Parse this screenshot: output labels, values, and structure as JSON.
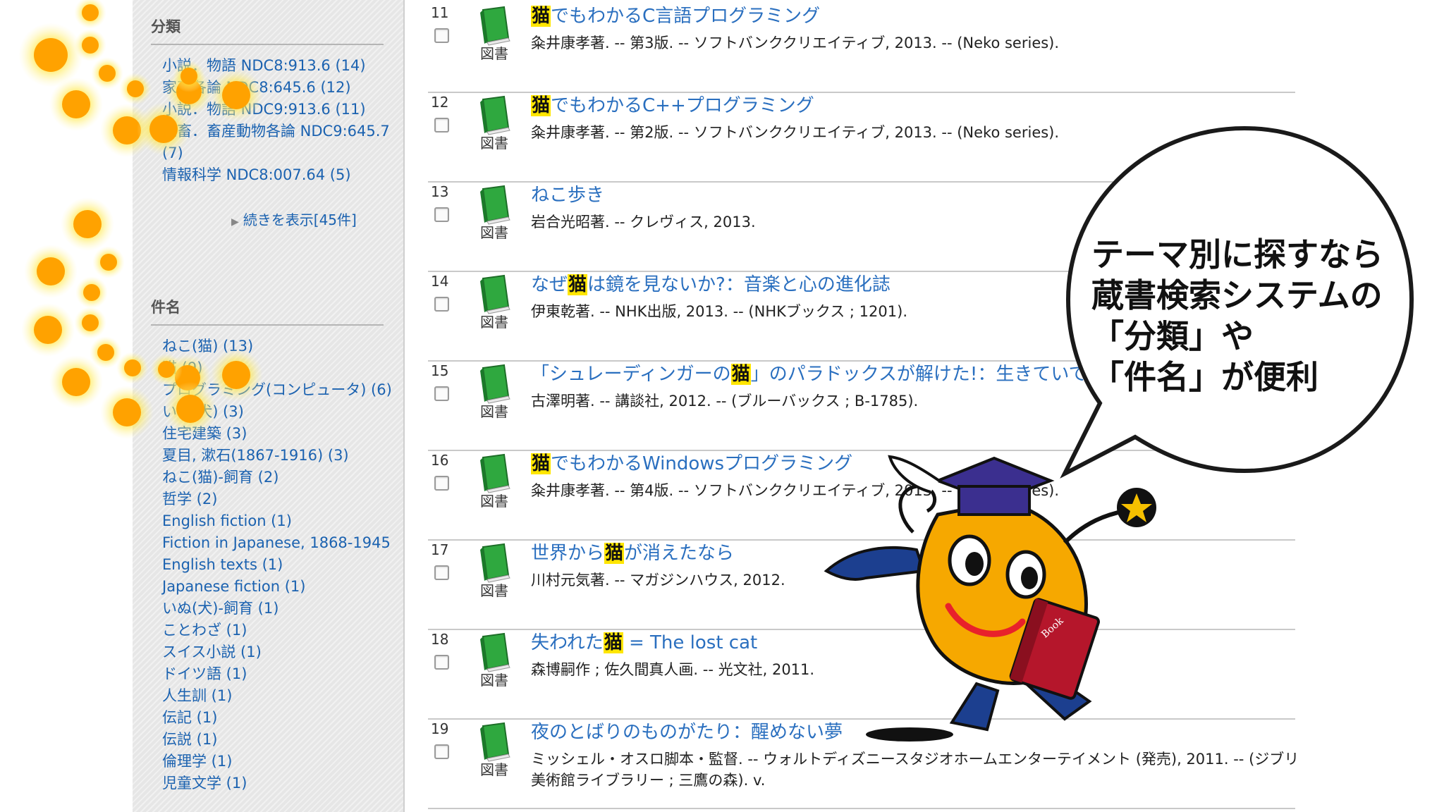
{
  "sidebar": {
    "classification": {
      "heading": "分類",
      "items": [
        "小説．物語 NDC8:913.6 (14)",
        "家畜各論 NDC8:645.6 (12)",
        "小説．物語 NDC9:913.6 (11)",
        "家畜．畜産動物各論 NDC9:645.7 (7)",
        "情報科学 NDC8:007.64 (5)"
      ],
      "show_more": "続きを表示[45件]"
    },
    "subjects": {
      "heading": "件名",
      "items": [
        "ねこ(猫) (13)",
        "猫 (9)",
        "プログラミング(コンピュータ) (6)",
        "いぬ(犬) (3)",
        "住宅建築 (3)",
        "夏目, 漱石(1867-1916) (3)",
        "ねこ(猫)-飼育 (2)",
        "哲学 (2)",
        "English fiction (1)",
        "Fiction in Japanese, 1868-1945 English texts (1)",
        "Japanese fiction (1)",
        "いぬ(犬)-飼育 (1)",
        "ことわざ (1)",
        "スイス小説 (1)",
        "ドイツ語 (1)",
        "人生訓 (1)",
        "伝記 (1)",
        "伝説 (1)",
        "倫理学 (1)",
        "児童文学 (1)"
      ]
    }
  },
  "results": [
    {
      "num": "11",
      "type": "図書",
      "title_before": "",
      "title_highlight": "猫",
      "title_after": "でもわかるC言語プログラミング",
      "meta": "粂井康孝著. -- 第3版. -- ソフトバンククリエイティブ, 2013. -- (Neko series)."
    },
    {
      "num": "12",
      "type": "図書",
      "title_before": "",
      "title_highlight": "猫",
      "title_after": "でもわかるC++プログラミング",
      "meta": "粂井康孝著. -- 第2版. -- ソフトバンククリエイティブ, 2013. -- (Neko series)."
    },
    {
      "num": "13",
      "type": "図書",
      "title_before": "ねこ歩き",
      "title_highlight": "",
      "title_after": "",
      "meta": "岩合光昭著. -- クレヴィス, 2013."
    },
    {
      "num": "14",
      "type": "図書",
      "title_before": "なぜ",
      "title_highlight": "猫",
      "title_after": "は鏡を見ないか?：音楽と心の進化誌",
      "meta": "伊東乾著. -- NHK出版, 2013. -- (NHKブックス ; 1201)."
    },
    {
      "num": "15",
      "type": "図書",
      "title_before": "「シュレーディンガーの",
      "title_highlight": "猫",
      "title_after": "」のパラドックスが解けた!：生きていて死",
      "meta": "古澤明著. -- 講談社, 2012. -- (ブルーバックス ; B-1785)."
    },
    {
      "num": "16",
      "type": "図書",
      "title_before": "",
      "title_highlight": "猫",
      "title_after": "でもわかるWindowsプログラミング",
      "meta": "粂井康孝著. -- 第4版. -- ソフトバンククリエイティブ, 2013. -- (Neko series)."
    },
    {
      "num": "17",
      "type": "図書",
      "title_before": "世界から",
      "title_highlight": "猫",
      "title_after": "が消えたなら",
      "meta": "川村元気著. -- マガジンハウス, 2012."
    },
    {
      "num": "18",
      "type": "図書",
      "title_before": "失われた",
      "title_highlight": "猫",
      "title_after": " = The lost cat",
      "meta": "森博嗣作 ; 佐久間真人画. -- 光文社, 2011."
    },
    {
      "num": "19",
      "type": "図書",
      "title_before": "夜のとばりのものがたり：醒めない夢",
      "title_highlight": "",
      "title_after": "",
      "meta": "ミッシェル・オスロ脚本・監督. -- ウォルトディズニースタジオホームエンターテイメント (発売), 2011. -- (ジブリ美術館ライブラリー ; 三鷹の森). v."
    }
  ],
  "callout": {
    "lines": [
      "テーマ別に探すなら",
      "蔵書検索システムの",
      "「分類」や",
      "「件名」が便利"
    ]
  },
  "mascot": {
    "book_label": "Book"
  },
  "colors": {
    "link": "#2a6fbf",
    "highlight": "#ffe600",
    "dot": "#ffa200",
    "mascot_body": "#f6a800",
    "book_green": "#2fa83f"
  }
}
